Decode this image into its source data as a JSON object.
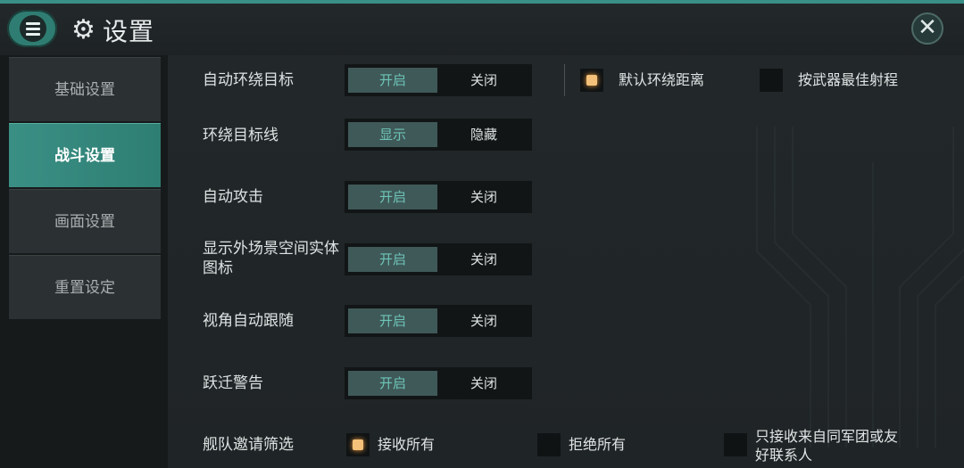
{
  "header": {
    "title": "设置",
    "menu_icon": "menu-icon",
    "settings_icon": "gear-icon",
    "close_icon": "close-icon"
  },
  "sidebar": {
    "items": [
      {
        "label": "基础设置",
        "active": false
      },
      {
        "label": "战斗设置",
        "active": true
      },
      {
        "label": "画面设置",
        "active": false
      },
      {
        "label": "重置设定",
        "active": false
      }
    ]
  },
  "settings": {
    "rows": [
      {
        "label": "自动环绕目标",
        "on": "开启",
        "off": "关闭"
      },
      {
        "label": "环绕目标线",
        "on": "显示",
        "off": "隐藏"
      },
      {
        "label": "自动攻击",
        "on": "开启",
        "off": "关闭"
      },
      {
        "label": "显示外场景空间实体图标",
        "on": "开启",
        "off": "关闭"
      },
      {
        "label": "视角自动跟随",
        "on": "开启",
        "off": "关闭"
      },
      {
        "label": "跃迁警告",
        "on": "开启",
        "off": "关闭"
      }
    ],
    "orbit_options": [
      {
        "label": "默认环绕距离",
        "checked": true
      },
      {
        "label": "按武器最佳射程",
        "checked": false
      }
    ],
    "fleet_invite": {
      "label": "舰队邀请筛选",
      "options": [
        {
          "label": "接收所有",
          "checked": true
        },
        {
          "label": "拒绝所有",
          "checked": false
        },
        {
          "label": "只接收来自同军团或友好联系人",
          "checked": false
        }
      ]
    }
  },
  "colors": {
    "accent": "#3a8f84",
    "toggle_on_text": "#6ec4b7",
    "check_mark": "#f4c17a"
  }
}
